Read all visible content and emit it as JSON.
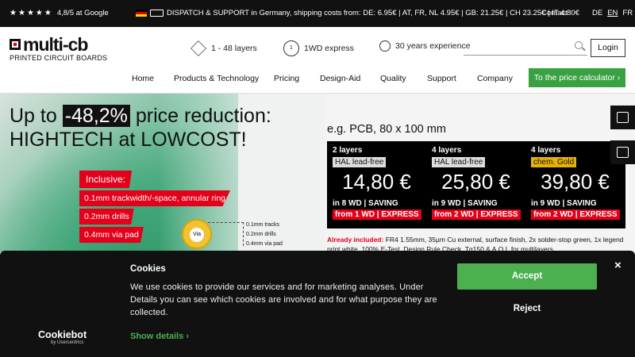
{
  "topbar": {
    "rating": "4,8/5 at Google",
    "dispatch": "DISPATCH & SUPPORT in Germany, shipping costs from: DE: 6.95€ | AT, FR, NL 4.95€ | GB: 21.25€ | CH 23.25€ | IT 4.80€",
    "contact": "Contact",
    "langs": [
      "DE",
      "EN",
      "FR"
    ]
  },
  "header": {
    "logo_name": "multi-cb",
    "logo_sub": "PRINTED CIRCUIT BOARDS",
    "features": [
      "1 - 48 layers",
      "1WD express",
      "30 years experience"
    ],
    "login": "Login"
  },
  "nav": {
    "items": [
      "Home",
      "Products & Technology",
      "Pricing",
      "Design-Aid",
      "Quality",
      "Support",
      "Company"
    ],
    "cta": "To the price calculator"
  },
  "hero": {
    "line1_pre": "Up to ",
    "line1_highlight": "-48,2%",
    "line1_post": " price reduction:",
    "line2": "HIGHTECH at LOWCOST!",
    "inclusive_title": "Inclusive:",
    "inclusive_items": [
      "0.1mm trackwidth/-space, annular ring",
      "0.2mm drills",
      "0.4mm via pad"
    ],
    "via_label": "Via",
    "via_labels": [
      "0.1mm tracks",
      "0.2mm drills",
      "0.4mm via pad"
    ],
    "example": "e.g. PCB, 80 x 100 mm",
    "prices": [
      {
        "layers": "2 layers",
        "finish": "HAL lead-free",
        "price": "14,80 €",
        "saving": "in 8 WD | SAVING",
        "express": "from 1 WD | EXPRESS"
      },
      {
        "layers": "4 layers",
        "finish": "HAL lead-free",
        "price": "25,80 €",
        "saving": "in 9 WD | SAVING",
        "express": "from 2 WD | EXPRESS"
      },
      {
        "layers": "4 layers",
        "finish": "chem. Gold",
        "price": "39,80 €",
        "saving": "in 9 WD | SAVING",
        "express": "from 2 WD | EXPRESS"
      }
    ],
    "already_label": "Already included:",
    "already_text": " FR4 1.55mm, 35µm Cu external, surface finish, 2x solder-stop green, 1x legend print white, 100% E-Test, Design Rule Check, Tg150 & A.O.I. for multilayers"
  },
  "cookie": {
    "brand": "Cookiebot",
    "brand_sub": "by Usercentrics",
    "title": "Cookies",
    "text": "We use cookies to provide our services and for marketing analyses. Under Details you can see which cookies are involved and for what purpose they are collected.",
    "details": "Show details",
    "accept": "Accept",
    "reject": "Reject",
    "close": "×"
  },
  "colors": {
    "accent_red": "#e2001a",
    "accept_green": "#4caf50",
    "cta_green": "#3aa142"
  }
}
